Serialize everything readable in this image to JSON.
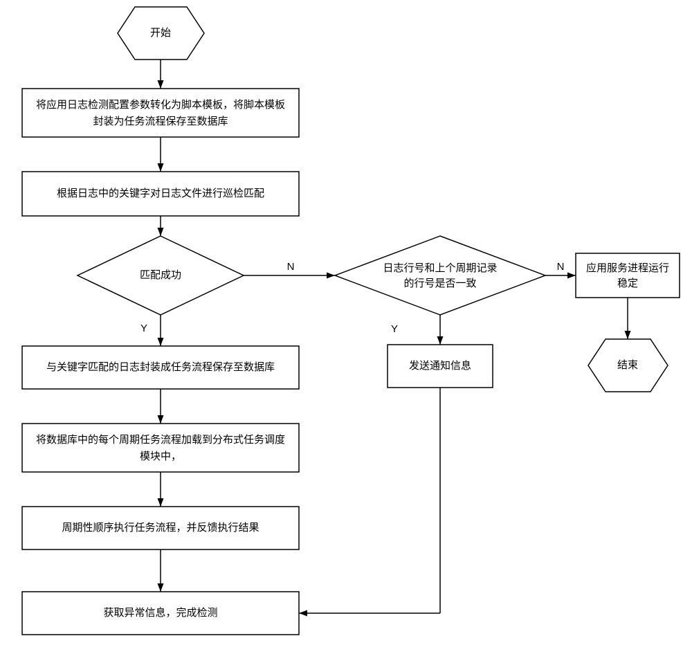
{
  "chart_data": {
    "type": "flowchart",
    "nodes": {
      "start": {
        "label": "开始",
        "shape": "hexagon"
      },
      "step1": {
        "label": "将应用日志检测配置参数转化为脚本模板，将脚本模板\n封装为任务流程保存至数据库",
        "shape": "rect"
      },
      "step2": {
        "label": "根据日志中的关键字对日志文件进行巡检匹配",
        "shape": "rect"
      },
      "dec1": {
        "label": "匹配成功",
        "shape": "diamond"
      },
      "step3": {
        "label": "与关键字匹配的日志封装成任务流程保存至数据库",
        "shape": "rect"
      },
      "step4": {
        "label": "将数据库中的每个周期任务流程加载到分布式任务调度\n模块中，",
        "shape": "rect"
      },
      "step5": {
        "label": "周期性顺序执行任务流程，并反馈执行结果",
        "shape": "rect"
      },
      "step6": {
        "label": "获取异常信息，完成检测",
        "shape": "rect"
      },
      "dec2": {
        "label": "日志行号和上个周期记录\n的行号是否一致",
        "shape": "diamond"
      },
      "notify": {
        "label": "发送通知信息",
        "shape": "rect"
      },
      "stable": {
        "label": "应用服务进程运行\n稳定",
        "shape": "rect"
      },
      "end": {
        "label": "结束",
        "shape": "hexagon"
      }
    },
    "edges": [
      {
        "from": "start",
        "to": "step1"
      },
      {
        "from": "step1",
        "to": "step2"
      },
      {
        "from": "step2",
        "to": "dec1"
      },
      {
        "from": "dec1",
        "to": "step3",
        "label": "Y"
      },
      {
        "from": "dec1",
        "to": "dec2",
        "label": "N"
      },
      {
        "from": "step3",
        "to": "step4"
      },
      {
        "from": "step4",
        "to": "step5"
      },
      {
        "from": "step5",
        "to": "step6"
      },
      {
        "from": "dec2",
        "to": "notify",
        "label": "Y"
      },
      {
        "from": "dec2",
        "to": "stable",
        "label": "N"
      },
      {
        "from": "notify",
        "to": "step6"
      },
      {
        "from": "stable",
        "to": "end"
      }
    ]
  },
  "labels": {
    "start": "开始",
    "s1a": "将应用日志检测配置参数转化为脚本模板，将脚本模板",
    "s1b": "封装为任务流程保存至数据库",
    "s2": "根据日志中的关键字对日志文件进行巡检匹配",
    "d1": "匹配成功",
    "s3": "与关键字匹配的日志封装成任务流程保存至数据库",
    "s4a": "将数据库中的每个周期任务流程加载到分布式任务调度",
    "s4b": "模块中，",
    "s5": "周期性顺序执行任务流程，并反馈执行结果",
    "s6": "获取异常信息，完成检测",
    "d2a": "日志行号和上个周期记录",
    "d2b": "的行号是否一致",
    "notify": "发送通知信息",
    "staba": "应用服务进程运行",
    "stabb": "稳定",
    "end": "结束",
    "Y": "Y",
    "N": "N"
  }
}
